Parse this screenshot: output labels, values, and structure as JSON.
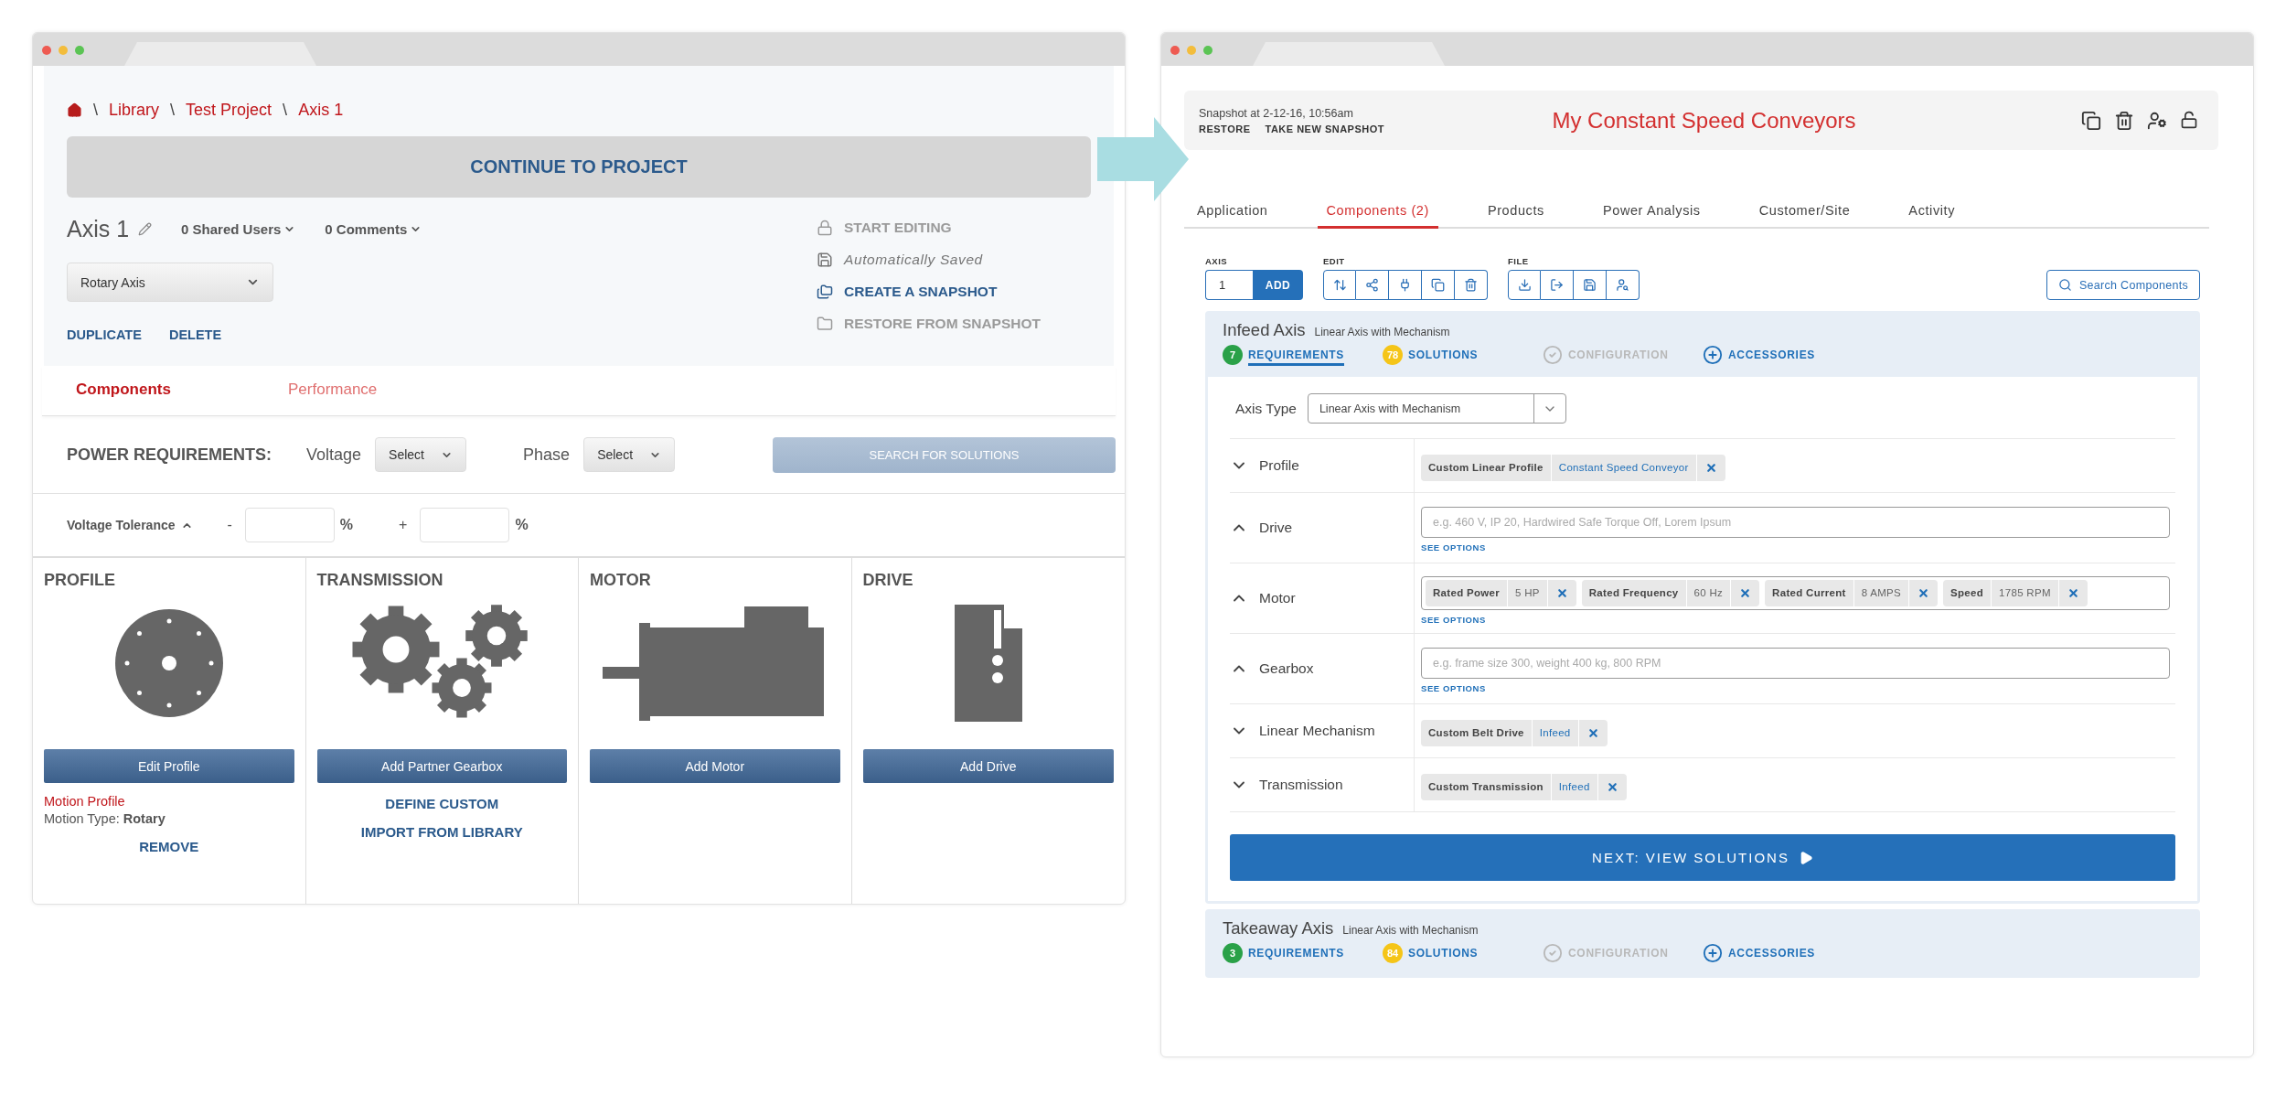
{
  "left_window": {
    "breadcrumb": [
      {
        "separator": "\\",
        "label": "Library"
      },
      {
        "separator": "\\",
        "label": "Test Project"
      },
      {
        "separator": "\\",
        "label": "Axis 1"
      }
    ],
    "continue_button": "CONTINUE TO PROJECT",
    "axis": {
      "title": "Axis 1",
      "shared_users": "0 Shared Users",
      "comments": "0 Comments",
      "axis_type": "Rotary Axis",
      "links": [
        "DUPLICATE",
        "DELETE"
      ]
    },
    "actions": [
      {
        "kind": "lock",
        "label": "START EDITING",
        "disabled": true
      },
      {
        "kind": "status",
        "label": "Automatically Saved",
        "disabled": false
      },
      {
        "kind": "snapshot",
        "label": "CREATE A SNAPSHOT",
        "disabled": false
      },
      {
        "kind": "restore",
        "label": "RESTORE FROM SNAPSHOT",
        "disabled": true
      }
    ],
    "tabs": [
      {
        "label": "Components",
        "selected": true
      },
      {
        "label": "Performance",
        "selected": false
      }
    ],
    "power": {
      "title": "POWER REQUIREMENTS:",
      "voltage": {
        "label": "Voltage",
        "value": "Select"
      },
      "phase": {
        "label": "Phase",
        "value": "Select"
      },
      "search_button": {
        "label": "SEARCH FOR SOLUTIONS",
        "disabled": true
      }
    },
    "tolerance": {
      "label": "Voltage Tolerance",
      "fields": [
        {
          "sign": "-",
          "unit": "%"
        },
        {
          "sign": "+",
          "unit": "%"
        }
      ]
    },
    "columns": [
      {
        "kind": "profile",
        "title": "PROFILE",
        "button": "Edit Profile",
        "notes": [
          {
            "kind": "title",
            "text": "Motion Profile"
          },
          {
            "kind": "detail",
            "text": "Motion Type: **Rotary**"
          }
        ],
        "links": [
          "REMOVE"
        ]
      },
      {
        "kind": "transmission",
        "title": "TRANSMISSION",
        "button": "Add Partner Gearbox",
        "links": [
          "DEFINE CUSTOM",
          "IMPORT FROM LIBRARY"
        ]
      },
      {
        "kind": "motor",
        "title": "MOTOR",
        "button": "Add Motor"
      },
      {
        "kind": "drive",
        "title": "DRIVE",
        "button": "Add Drive"
      }
    ]
  },
  "right_window": {
    "snapshot": {
      "caption": "Snapshot at 2-12-16, 10:56am",
      "links": [
        "RESTORE",
        "TAKE NEW SNAPSHOT"
      ],
      "title": "My Constant Speed Conveyors"
    },
    "tabs": [
      {
        "label": "Application",
        "selected": false
      },
      {
        "label": "Components (2)",
        "selected": true
      },
      {
        "label": "Products",
        "selected": false
      },
      {
        "label": "Power Analysis",
        "selected": false
      },
      {
        "label": "Customer/Site",
        "selected": false
      },
      {
        "label": "Activity",
        "selected": false
      }
    ],
    "toolbar": {
      "axis_label": "AXIS",
      "axis_value": "1",
      "add_button": "ADD",
      "edit_label": "EDIT",
      "file_label": "FILE",
      "search_button": "Search Components"
    },
    "axes": [
      {
        "name": "Infeed Axis",
        "type": "Linear Axis with Mechanism",
        "expanded": true,
        "steps": [
          {
            "kind": "requirements",
            "count": "7",
            "label": "REQUIREMENTS",
            "selected": true,
            "disabled": false
          },
          {
            "kind": "solutions",
            "count": "78",
            "label": "SOLUTIONS",
            "selected": false,
            "disabled": false
          },
          {
            "kind": "configuration",
            "label": "CONFIGURATION",
            "selected": false,
            "disabled": true
          },
          {
            "kind": "accessories",
            "label": "ACCESSORIES",
            "selected": false,
            "disabled": false
          }
        ],
        "axis_type": {
          "label": "Axis Type",
          "value": "Linear Axis with Mechanism"
        },
        "components": [
          {
            "kind": "tags",
            "label": "Profile",
            "expanded": false,
            "tags": [
              {
                "name": "Custom Linear Profile",
                "value": "Constant Speed Conveyor"
              }
            ]
          },
          {
            "kind": "input",
            "label": "Drive",
            "expanded": true,
            "placeholder": "e.g. 460 V, IP 20, Hardwired Safe Torque Off, Lorem Ipsum",
            "link": "SEE OPTIONS"
          },
          {
            "kind": "tag_field",
            "label": "Motor",
            "expanded": true,
            "tags": [
              {
                "name": "Rated Power",
                "value": "5 HP"
              },
              {
                "name": "Rated Frequency",
                "value": "60 Hz"
              },
              {
                "name": "Rated Current",
                "value": "8 AMPS"
              },
              {
                "name": "Speed",
                "value": "1785 RPM"
              }
            ],
            "link": "SEE OPTIONS"
          },
          {
            "kind": "input",
            "label": "Gearbox",
            "expanded": true,
            "placeholder": "e.g. frame size 300, weight 400 kg, 800 RPM",
            "link": "SEE OPTIONS"
          },
          {
            "kind": "tags",
            "label": "Linear Mechanism",
            "expanded": false,
            "tags": [
              {
                "name": "Custom Belt Drive",
                "value": "Infeed"
              }
            ]
          },
          {
            "kind": "tags",
            "label": "Transmission",
            "expanded": false,
            "tags": [
              {
                "name": "Custom Transmission",
                "value": "Infeed"
              }
            ]
          }
        ],
        "next_button": "NEXT: VIEW SOLUTIONS"
      },
      {
        "name": "Takeaway Axis",
        "type": "Linear Axis with Mechanism",
        "expanded": false,
        "steps": [
          {
            "kind": "requirements",
            "count": "3",
            "label": "REQUIREMENTS",
            "selected": false,
            "disabled": false
          },
          {
            "kind": "solutions",
            "count": "84",
            "label": "SOLUTIONS",
            "selected": false,
            "disabled": false
          },
          {
            "kind": "configuration",
            "label": "CONFIGURATION",
            "selected": false,
            "disabled": true
          },
          {
            "kind": "accessories",
            "label": "ACCESSORIES",
            "selected": false,
            "disabled": false
          }
        ]
      }
    ]
  }
}
